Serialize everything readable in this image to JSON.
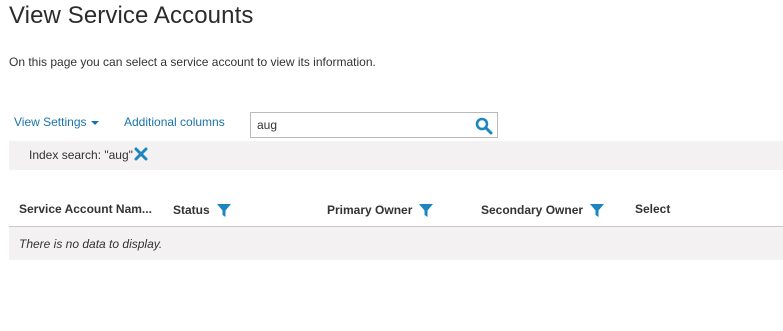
{
  "page": {
    "title": "View Service Accounts",
    "description": "On this page you can select a service account to view its information."
  },
  "toolbar": {
    "view_settings_label": "View Settings",
    "additional_columns_label": "Additional columns",
    "search": {
      "value": "aug",
      "icon": "search-icon"
    }
  },
  "index_filter": {
    "label": "Index search: \"aug\"",
    "clear_icon": "close-icon"
  },
  "grid": {
    "columns": [
      {
        "label": "Service Account Nam...",
        "filterable": false
      },
      {
        "label": "Status",
        "filterable": true
      },
      {
        "label": "Primary Owner",
        "filterable": true
      },
      {
        "label": "Secondary Owner",
        "filterable": true
      },
      {
        "label": "Select",
        "filterable": false
      }
    ],
    "empty_message": "There is no data to display."
  },
  "colors": {
    "accent": "#1a73a8",
    "filter_icon": "#1b86c0",
    "row_bg": "#f3f1f2",
    "title_text": "#2b2b2b"
  }
}
